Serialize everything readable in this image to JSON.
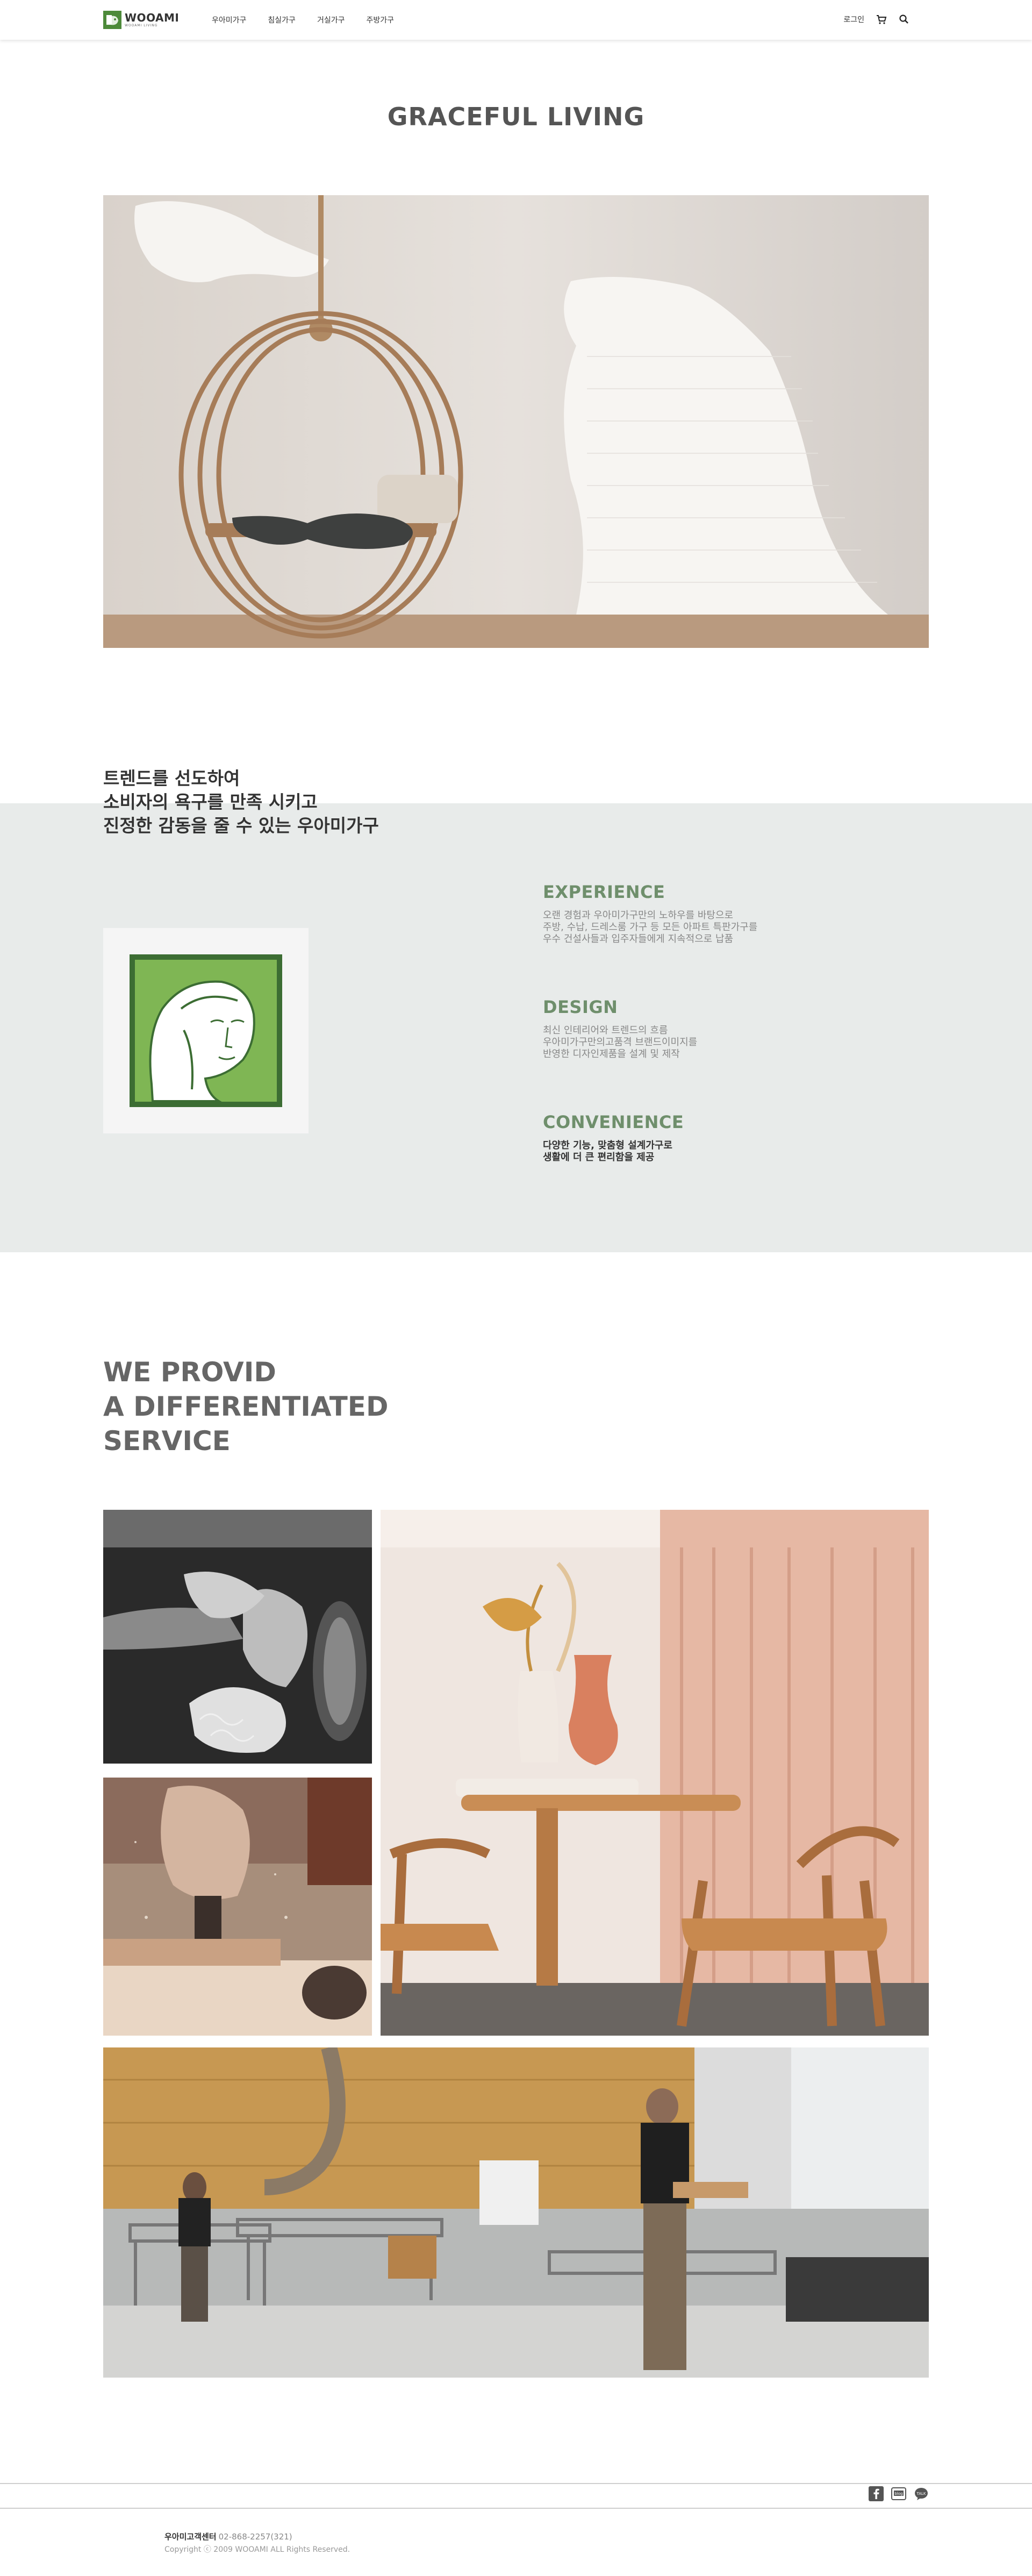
{
  "header": {
    "logo_name": "WOOAMI",
    "logo_sub": "WOOAMI LIVING",
    "nav": [
      "우아미가구",
      "침실가구",
      "거실가구",
      "주방가구"
    ],
    "login": "로그인"
  },
  "graceful": {
    "title": "GRACEFUL LIVING"
  },
  "trend": {
    "lines": [
      "트렌드를 선도하여",
      "소비자의 욕구를 만족 시키고",
      "진정한 감동을 줄 수 있는 우아미가구"
    ],
    "features": [
      {
        "title": "EXPERIENCE",
        "lines": [
          "오랜 경험과 우아미가구만의 노하우를 바탕으로",
          "주방, 수납, 드레스룸 가구 등 모든 아파트 특판가구를",
          "우수 건설사들과 입주자들에게 지속적으로 납품"
        ]
      },
      {
        "title": "DESIGN",
        "lines": [
          "최신 인테리어와 트렌드의 흐름",
          "우아미가구만의고품격 브랜드이미지를",
          "반영한 디자인제품을 설계 및 제작"
        ]
      },
      {
        "title": "CONVENIENCE",
        "lines": [
          "다양한 기능, 맞춤형 설계가구로",
          "생활에 더 큰 편리함을 제공"
        ]
      }
    ]
  },
  "provide": {
    "lines": [
      "WE PROVID",
      "A DIFFERENTIATED",
      "SERVICE"
    ]
  },
  "footer": {
    "cs_label": "우아미고객센터",
    "cs_phone": "02-868-2257(321)",
    "copyright": "Copyright ⓒ 2009 WOOAMI ALL Rights Reserved."
  },
  "colors": {
    "accent_green": "#6f8f6c",
    "band_bg": "#e8ebea",
    "logo_green": "#4d8a3a"
  }
}
